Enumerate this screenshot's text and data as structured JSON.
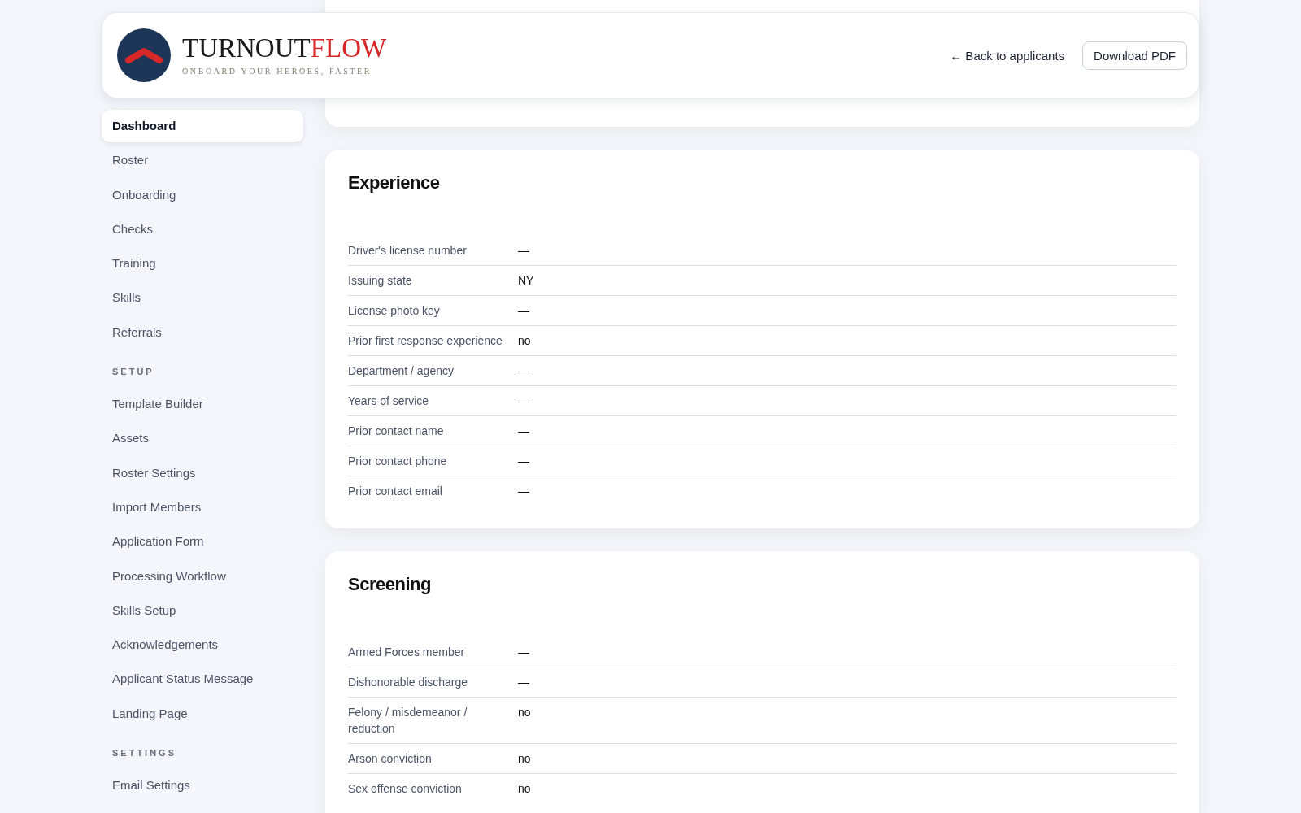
{
  "header": {
    "brand_primary": "TURNOUT",
    "brand_accent": "FLOW",
    "tagline": "ONBOARD YOUR HEROES, FASTER",
    "back_link": "← Back to applicants",
    "download_button": "Download PDF"
  },
  "sidebar": {
    "sections": [
      {
        "items": [
          {
            "label": "Dashboard",
            "selected": true
          },
          {
            "label": "Roster",
            "selected": false
          },
          {
            "label": "Onboarding",
            "selected": false
          },
          {
            "label": "Checks",
            "selected": false
          },
          {
            "label": "Training",
            "selected": false
          },
          {
            "label": "Skills",
            "selected": false
          },
          {
            "label": "Referrals",
            "selected": false
          }
        ]
      },
      {
        "heading": "SETUP",
        "items": [
          {
            "label": "Template Builder",
            "selected": false
          },
          {
            "label": "Assets",
            "selected": false
          },
          {
            "label": "Roster Settings",
            "selected": false
          },
          {
            "label": "Import Members",
            "selected": false
          },
          {
            "label": "Application Form",
            "selected": false
          },
          {
            "label": "Processing Workflow",
            "selected": false
          },
          {
            "label": "Skills Setup",
            "selected": false
          },
          {
            "label": "Acknowledgements",
            "selected": false
          },
          {
            "label": "Applicant Status Message",
            "selected": false
          },
          {
            "label": "Landing Page",
            "selected": false
          }
        ]
      },
      {
        "heading": "SETTINGS",
        "items": [
          {
            "label": "Email Settings",
            "selected": false
          }
        ]
      }
    ]
  },
  "cards": [
    {
      "title": "Experience",
      "fields": [
        {
          "label": "Driver's license number",
          "value": "—"
        },
        {
          "label": "Issuing state",
          "value": "NY"
        },
        {
          "label": "License photo key",
          "value": "—"
        },
        {
          "label": "Prior first response experience",
          "value": "no"
        },
        {
          "label": "Department / agency",
          "value": "—"
        },
        {
          "label": "Years of service",
          "value": "—"
        },
        {
          "label": "Prior contact name",
          "value": "—"
        },
        {
          "label": "Prior contact phone",
          "value": "—"
        },
        {
          "label": "Prior contact email",
          "value": "—"
        }
      ]
    },
    {
      "title": "Screening",
      "fields": [
        {
          "label": "Armed Forces member",
          "value": "—"
        },
        {
          "label": "Dishonorable discharge",
          "value": "—"
        },
        {
          "label": "Felony / misdemeanor / reduction",
          "value": "no"
        },
        {
          "label": "Arson conviction",
          "value": "no"
        },
        {
          "label": "Sex offense conviction",
          "value": "no"
        }
      ]
    }
  ]
}
